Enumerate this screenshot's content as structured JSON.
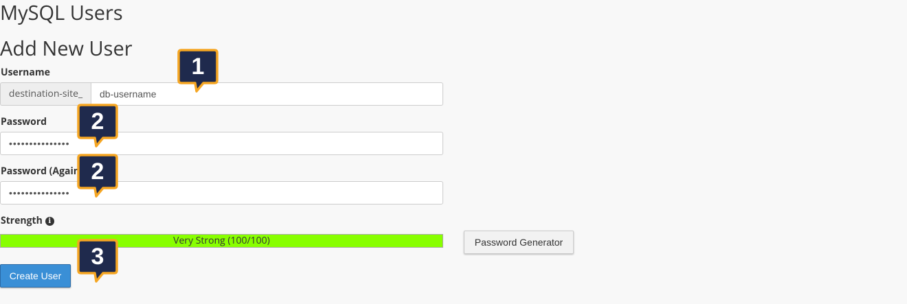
{
  "page": {
    "title": "MySQL Users",
    "section_title": "Add New User"
  },
  "username": {
    "label": "Username",
    "prefix": "destination-site_",
    "value": "db-username"
  },
  "password": {
    "label": "Password",
    "value": "•••••••••••••••"
  },
  "password_again": {
    "label": "Password (Again",
    "value": "•••••••••••••••"
  },
  "strength": {
    "label": "Strength",
    "info_icon": "info-icon",
    "text": "Very Strong (100/100)",
    "value": 100,
    "bar_color": "#88ff00"
  },
  "buttons": {
    "password_generator": "Password Generator",
    "create_user": "Create User"
  },
  "callouts": [
    {
      "number": "1"
    },
    {
      "number": "2"
    },
    {
      "number": "2"
    },
    {
      "number": "3"
    }
  ],
  "colors": {
    "callout_fill": "#1f2a4d",
    "callout_border": "#f5a623",
    "primary_button": "#3a8fd6"
  }
}
